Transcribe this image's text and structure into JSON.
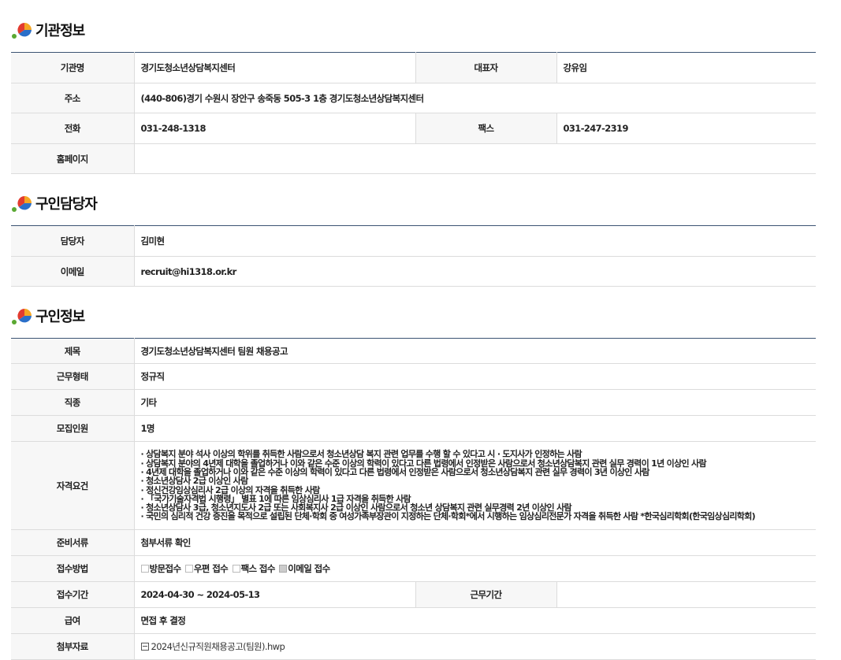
{
  "sections": {
    "org": {
      "title": "기관정보"
    },
    "contact": {
      "title": "구인담당자"
    },
    "job": {
      "title": "구인정보"
    }
  },
  "org": {
    "name_label": "기관명",
    "name": "경기도청소년상담복지센터",
    "rep_label": "대표자",
    "rep": "강유임",
    "address_label": "주소",
    "address": "(440-806)경기 수원시 장안구 송죽동 505-3 1층 경기도청소년상담복지센터",
    "phone_label": "전화",
    "phone": "031-248-1318",
    "fax_label": "팩스",
    "fax": "031-247-2319",
    "homepage_label": "홈페이지",
    "homepage": ""
  },
  "contact": {
    "person_label": "담당자",
    "person": "김미현",
    "email_label": "이메일",
    "email": "recruit@hi1318.or.kr"
  },
  "job": {
    "title_label": "제목",
    "title": "경기도청소년상담복지센터 팀원 채용공고",
    "type_label": "근무형태",
    "type": "정규직",
    "category_label": "직종",
    "category": "기타",
    "headcount_label": "모집인원",
    "headcount": "1명",
    "qual_label": "자격요건",
    "qualifications": [
      "· 상담복지 분야 석사 이상의 학위를 취득한 사람으로서 청소년상담 복지 관련 업무를 수행  할 수 있다고 시 · 도지사가 인정하는 사람",
      "· 상담복지 분야의 4년제 대학을 졸업하거나 이와 같은 수준 이상의 학력이 있다고 다른 법령에서 인정받은 사람으로서 청소년상담복지 관련 실무 경력이 1년 이상인 사람",
      "· 4년제 대학을 졸업하거나 이와 같은 수준 이상의 학력이 있다고 다른 법령에서 인정받은 사람으로서 청소년상담복지 관련 실무 경력이 3년 이상인 사람",
      "· 청소년상담사 2급 이상인 사람",
      "· 정신건강임상심리사 2급 이상의 자격을 취득한 사람",
      "· 「국가기술자격법 시행령」 별표 1에 따른 임상심리사 1급 자격을 취득한 사람",
      "· 청소년상담사 3급, 청소년지도사 2급 또는 사회복지사 2급 이상인 사람으로서 청소년 상담복지 관련 실무경력 2년 이상인 사람",
      "· 국민의 심리적 건강 증진을 목적으로 설립된 단체·학회 중 여성가족부장관이 지정하는 단체·학회*에서 시행하는 임상심리전문가 자격을 취득한 사람   *한국심리학회(한국임상심리학회)"
    ],
    "docs_label": "준비서류",
    "docs": "첨부서류 확인",
    "method_label": "접수방법",
    "methods": [
      {
        "label": "방문접수",
        "checked": false
      },
      {
        "label": "우편 접수",
        "checked": false
      },
      {
        "label": "팩스 접수",
        "checked": false
      },
      {
        "label": "이메일 접수",
        "checked": true
      }
    ],
    "period_label": "접수기간",
    "period": "2024-04-30 ~ 2024-05-13",
    "work_period_label": "근무기간",
    "work_period": "",
    "salary_label": "급여",
    "salary": "면접 후 결정",
    "attach_label": "첨부자료",
    "attachment": "2024년신규직원채용공고(팀원).hwp"
  }
}
